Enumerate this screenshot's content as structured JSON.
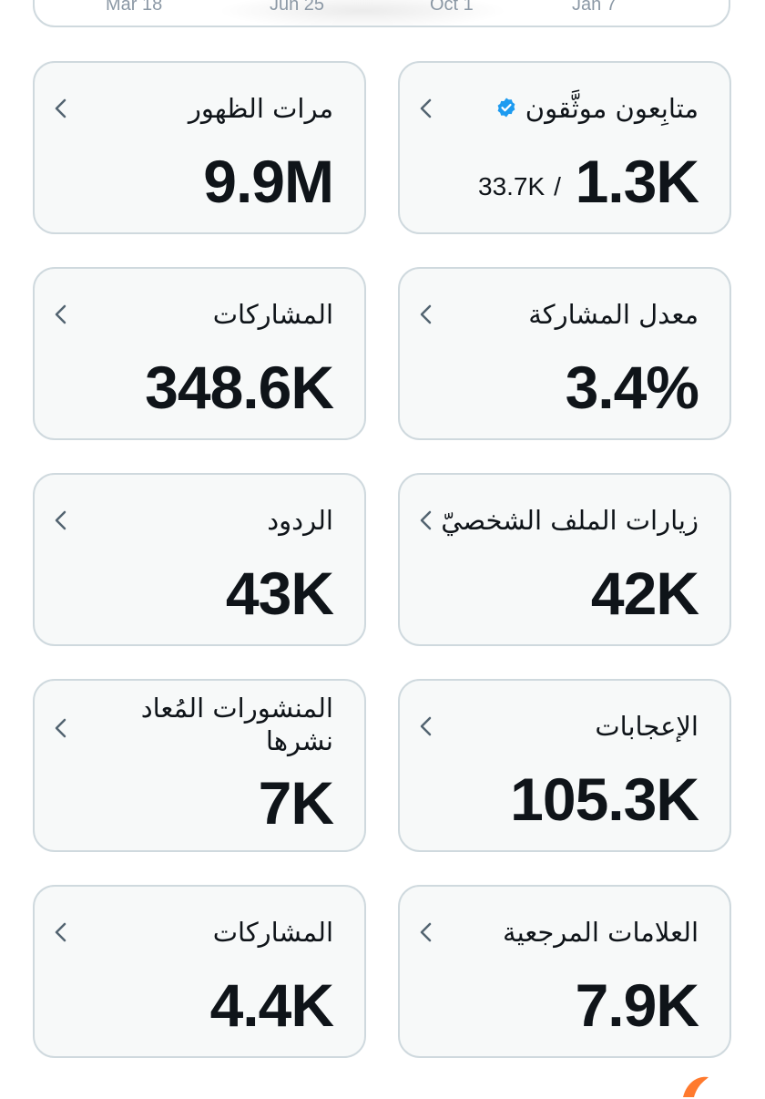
{
  "top_card": {
    "ticks": [
      "Mar 18",
      "Jun 25",
      "Oct 1",
      "Jan 7"
    ]
  },
  "cards": {
    "verified_followers": {
      "label": "متابِعون موثَّقون",
      "value": "1.3K",
      "secondary": "33.7K",
      "secondary_sep": "/"
    },
    "impressions": {
      "label": "مرات الظهور",
      "value": "9.9M"
    },
    "engagement_rate": {
      "label": "معدل المشاركة",
      "value": "3.4%"
    },
    "engagements": {
      "label": "المشاركات",
      "value": "348.6K"
    },
    "profile_visits": {
      "label": "زيارات الملف الشخصيّ",
      "value": "42K"
    },
    "replies": {
      "label": "الردود",
      "value": "43K"
    },
    "likes": {
      "label": "الإعجابات",
      "value": "105.3K"
    },
    "reposts": {
      "label": "المنشورات المُعاد نشرها",
      "value": "7K"
    },
    "bookmarks": {
      "label": "العلامات المرجعية",
      "value": "7.9K"
    },
    "shares": {
      "label": "المشاركات",
      "value": "4.4K"
    }
  },
  "colors": {
    "card_bg": "#f7f9f9",
    "border": "#cfd9de",
    "text": "#0f1419",
    "verified_blue": "#1d9bf0",
    "accent_orange": "#ff7a2e"
  },
  "icons": {
    "chevron": "chevron-left-icon",
    "verified": "verified-badge-icon"
  }
}
